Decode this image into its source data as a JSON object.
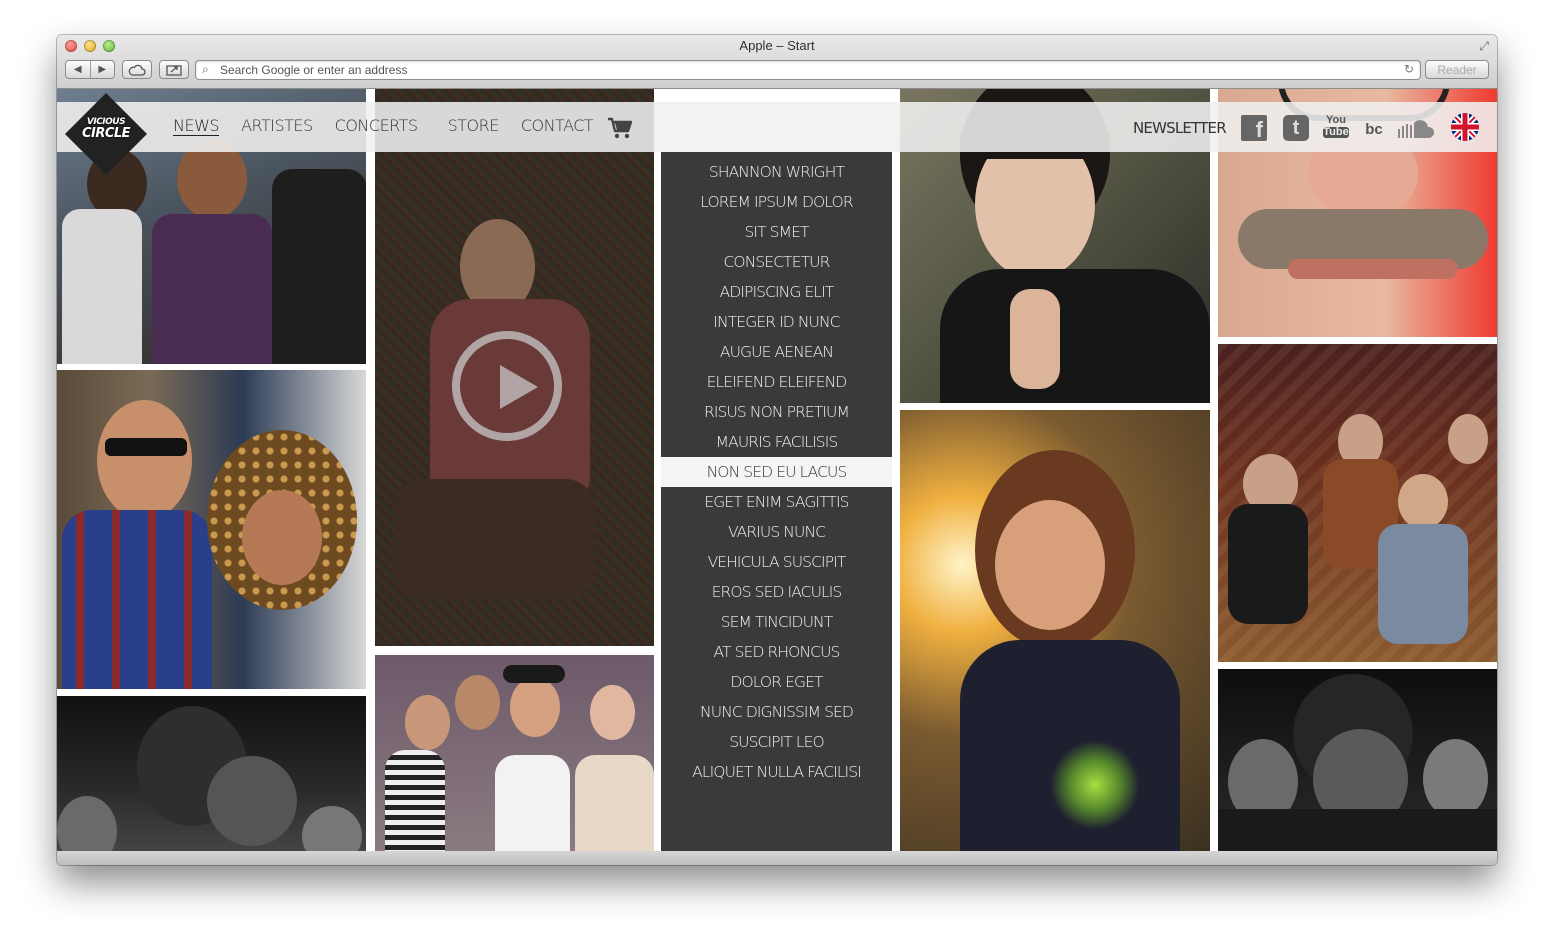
{
  "window": {
    "title": "Apple – Start"
  },
  "toolbar": {
    "back_glyph": "◀",
    "forward_glyph": "▶",
    "address_placeholder": "Search Google or enter an address",
    "reader_label": "Reader"
  },
  "site": {
    "logo": {
      "line1": "VICIOUS",
      "line2": "CIRCLE"
    },
    "nav": [
      {
        "label": "NEWS",
        "active": true
      },
      {
        "label": "ARTISTES"
      },
      {
        "label": "CONCERTS"
      },
      {
        "label": "STORE"
      },
      {
        "label": "CONTACT"
      }
    ],
    "newsletter": "NEWSLETTER",
    "social": {
      "facebook_glyph": "f",
      "twitter_glyph": "t",
      "youtube_top": "You",
      "youtube_bottom": "Tube",
      "bandcamp": "bc"
    },
    "artist_menu": [
      "SHANNON WRIGHT",
      "LOREM IPSUM DOLOR",
      "SIT SMET",
      "CONSECTETUR",
      "ADIPISCING ELIT",
      "INTEGER ID NUNC",
      "AUGUE AENEAN",
      "ELEIFEND ELEIFEND",
      "RISUS NON PRETIUM",
      "MAURIS FACILISIS",
      "NON SED EU LACUS",
      "EGET ENIM SAGITTIS",
      "VARIUS NUNC",
      "VEHICULA SUSCIPIT",
      "EROS SED IACULIS",
      "SEM TINCIDUNT",
      "AT SED RHONCUS",
      "DOLOR EGET",
      "NUNC DIGNISSIM SED",
      "SUSCIPIT LEO",
      "ALIQUET NULLA FACILISI"
    ],
    "active_menu_index": 10
  },
  "icons": {
    "cart": "cart-icon",
    "play": "play-icon",
    "search": "search-icon",
    "reload": "reload-icon",
    "fullscreen": "fullscreen-icon"
  },
  "colors": {
    "menu_bg": "#3a3a3a",
    "topbar_bg": "#f0f0f0",
    "accent_flag_red": "#cf142b",
    "accent_flag_blue": "#00247d"
  }
}
